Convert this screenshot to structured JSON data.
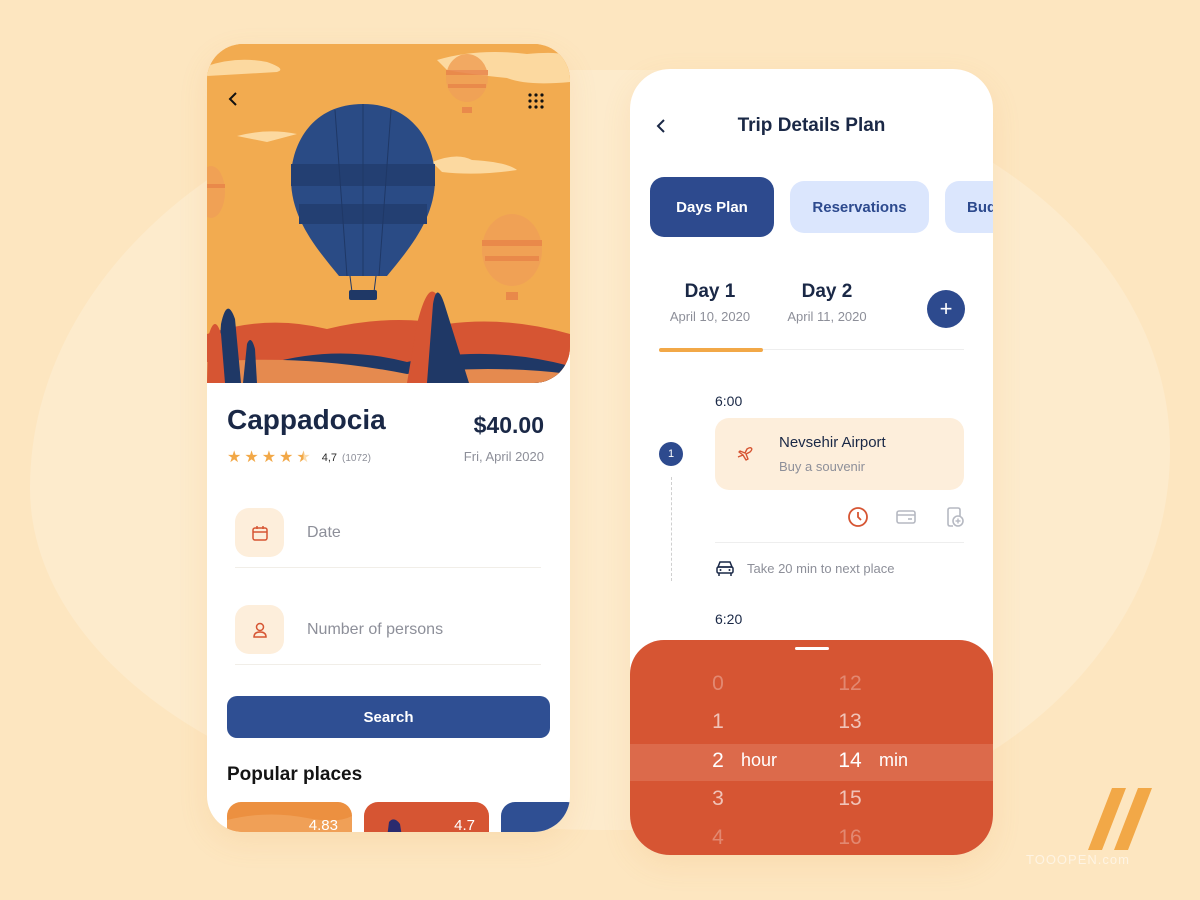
{
  "colors": {
    "background": "#fde6c0",
    "primary": "#2d4a8e",
    "accent_orange": "#f2a847",
    "sheet_red": "#d65533",
    "chip_light": "#dbe6fd",
    "card_cream": "#fdeedb"
  },
  "left_screen": {
    "header_icons": {
      "back": "chevron-left-icon",
      "menu": "grid-dots-icon"
    },
    "place": {
      "title": "Cappadocia",
      "price": "$40.00",
      "date": "Fri, April 2020",
      "rating": {
        "stars": 4.5,
        "max_stars": 5,
        "value": "4,7",
        "count": "(1072)"
      }
    },
    "form": {
      "date_placeholder": "Date",
      "persons_placeholder": "Number of persons",
      "search_label": "Search"
    },
    "popular": {
      "title": "Popular places",
      "cards": [
        {
          "rating": "4.83"
        },
        {
          "rating": "4.7"
        },
        {
          "rating": ""
        }
      ]
    }
  },
  "right_screen": {
    "title": "Trip Details Plan",
    "tabs": [
      {
        "label": "Days Plan",
        "active": true
      },
      {
        "label": "Reservations",
        "active": false
      },
      {
        "label": "Budget",
        "active": false
      }
    ],
    "days": [
      {
        "name": "Day 1",
        "date": "April 10, 2020",
        "active": true
      },
      {
        "name": "Day 2",
        "date": "April 11, 2020",
        "active": false
      }
    ],
    "add_day_label": "+",
    "timeline": [
      {
        "time": "6:00",
        "step": "1",
        "title": "Nevsehir Airport",
        "subtitle": "Buy a souvenir",
        "transit": "Take 20 min to next place"
      },
      {
        "time": "6:20"
      }
    ],
    "picker": {
      "hours": [
        "0",
        "1",
        "2",
        "3",
        "4"
      ],
      "minutes": [
        "12",
        "13",
        "14",
        "15",
        "16"
      ],
      "selected_hour": "2",
      "selected_minute": "14",
      "hour_unit": "hour",
      "minute_unit": "min"
    }
  },
  "watermark": "TOOOPEN.com"
}
